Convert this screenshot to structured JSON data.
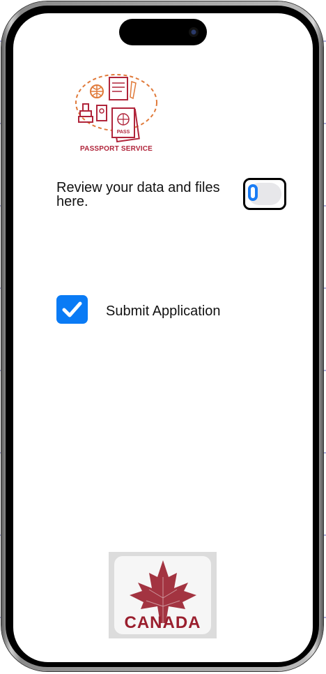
{
  "logo": {
    "caption": "PASSPORT SERVICE",
    "icon": "passport-service-icon",
    "color": "#b0243a",
    "accent": "#e07a3a"
  },
  "review": {
    "text": "Review your data and files here.",
    "toggle_on": true
  },
  "submit": {
    "label": "Submit Application",
    "checked": true,
    "accent": "#0a7bf5"
  },
  "canada_logo": {
    "text": "CANADA",
    "icon": "maple-leaf-icon",
    "color": "#9a1f2e"
  }
}
